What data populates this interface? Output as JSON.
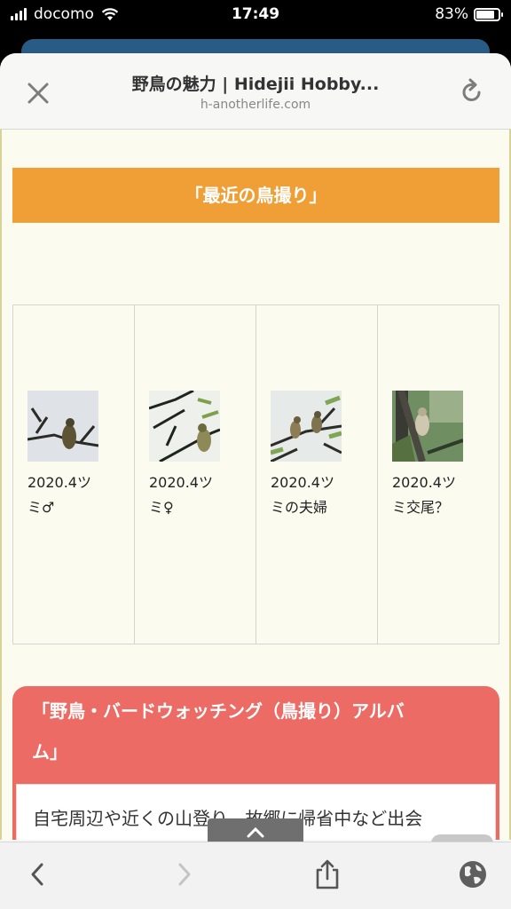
{
  "status_bar": {
    "carrier": "docomo",
    "time": "17:49",
    "battery_percent": "83%",
    "battery_level": 0.83
  },
  "browser": {
    "title": "野鳥の魅力 | Hidejii Hobby...",
    "url": "h-anotherlife.com"
  },
  "page": {
    "section_heading": "「最近の鳥撮り」",
    "gallery": [
      {
        "caption_line1": "2020.4ツ",
        "caption_line2": "ミ♂"
      },
      {
        "caption_line1": "2020.4ツ",
        "caption_line2": "ミ♀"
      },
      {
        "caption_line1": "2020.4ツ",
        "caption_line2": "ミの夫婦"
      },
      {
        "caption_line1": "2020.4ツ",
        "caption_line2": "ミ交尾？"
      }
    ],
    "album_heading_line1": "「野鳥・バードウォッチング（鳥撮り）アルバ",
    "album_heading_line2": "ム」",
    "album_text": "自宅周辺や近くの山登り、故郷に帰省中など出会"
  },
  "icons": {
    "close": "close-icon",
    "reload": "reload-icon",
    "back": "chevron-left-icon",
    "forward": "chevron-right-icon",
    "share": "share-icon",
    "globe": "globe-icon"
  },
  "colors": {
    "orange_heading": "#ef9f36",
    "red_card": "#ec6b65",
    "page_background": "#fcfbf0"
  }
}
